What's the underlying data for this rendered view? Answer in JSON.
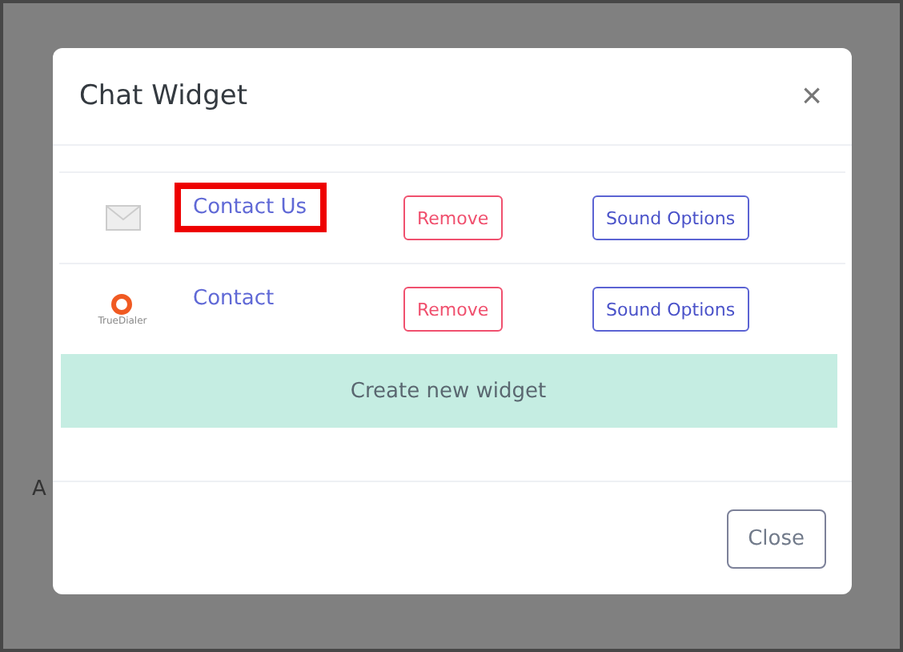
{
  "background": {
    "cell_text": "A"
  },
  "dialog": {
    "title": "Chat Widget",
    "close_symbol": "×",
    "widgets": [
      {
        "kind": "mail",
        "name": "Contact Us",
        "highlighted": true,
        "remove": "Remove",
        "sound": "Sound Options"
      },
      {
        "kind": "logo",
        "logo_text": "TrueDialer",
        "name": "Contact",
        "highlighted": false,
        "remove": "Remove",
        "sound": "Sound Options"
      }
    ],
    "create": "Create new widget",
    "footer_button": "Close"
  }
}
